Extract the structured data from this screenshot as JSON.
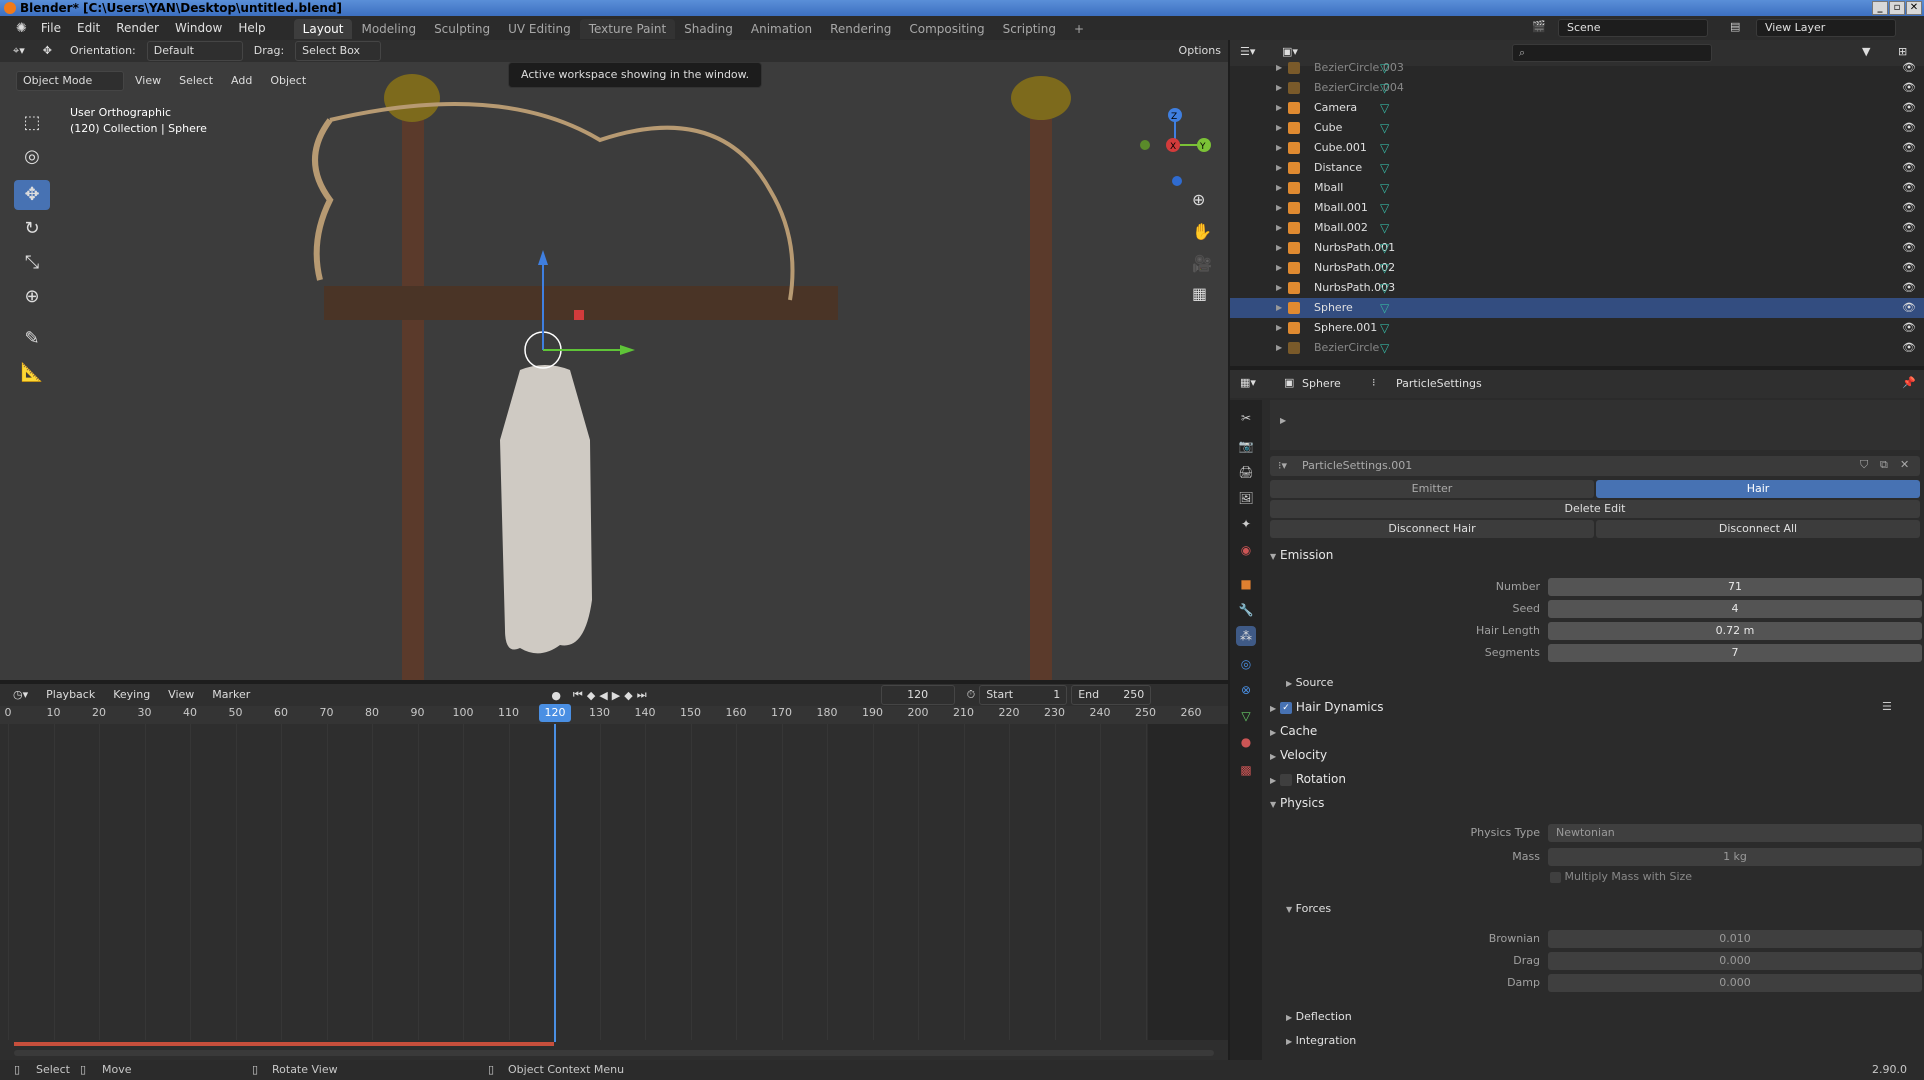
{
  "window": {
    "title": "Blender* [C:\\Users\\YAN\\Desktop\\untitled.blend]"
  },
  "menu": [
    "File",
    "Edit",
    "Render",
    "Window",
    "Help"
  ],
  "workspaces": [
    "Layout",
    "Modeling",
    "Sculpting",
    "UV Editing",
    "Texture Paint",
    "Shading",
    "Animation",
    "Rendering",
    "Compositing",
    "Scripting"
  ],
  "active_workspace": "Layout",
  "scene": {
    "label": "Scene",
    "view_layer": "View Layer"
  },
  "viewport": {
    "orientation_label": "Orientation:",
    "orientation_value": "Default",
    "drag_label": "Drag:",
    "drag_value": "Select Box",
    "options_label": "Options",
    "mode": "Object Mode",
    "header_menus": [
      "View",
      "Select",
      "Add",
      "Object"
    ],
    "tooltip": "Active workspace showing in the window.",
    "overlay_view": "User Orthographic",
    "overlay_collection": "(120) Collection | Sphere",
    "gizmo_axes": {
      "z": "Z",
      "x": "X",
      "y": "Y"
    }
  },
  "timeline": {
    "menus": [
      "Playback",
      "Keying",
      "View",
      "Marker"
    ],
    "current_frame": "120",
    "start_label": "Start",
    "start_value": "1",
    "end_label": "End",
    "end_value": "250",
    "frame_ticks": [
      "0",
      "10",
      "20",
      "30",
      "40",
      "50",
      "60",
      "70",
      "80",
      "90",
      "100",
      "110",
      "120",
      "130",
      "140",
      "150",
      "160",
      "170",
      "180",
      "190",
      "200",
      "210",
      "220",
      "230",
      "240",
      "250",
      "260"
    ]
  },
  "outliner": {
    "items": [
      {
        "label": "BezierCircle.003",
        "faded": true
      },
      {
        "label": "BezierCircle.004",
        "faded": true
      },
      {
        "label": "Camera"
      },
      {
        "label": "Cube"
      },
      {
        "label": "Cube.001"
      },
      {
        "label": "Distance"
      },
      {
        "label": "Mball"
      },
      {
        "label": "Mball.001"
      },
      {
        "label": "Mball.002"
      },
      {
        "label": "NurbsPath.001"
      },
      {
        "label": "NurbsPath.002"
      },
      {
        "label": "NurbsPath.003"
      },
      {
        "label": "Sphere",
        "selected": true
      },
      {
        "label": "Sphere.001"
      },
      {
        "label": "BezierCircle",
        "faded": true
      }
    ]
  },
  "properties": {
    "breadcrumb_object": "Sphere",
    "breadcrumb_settings": "ParticleSettings",
    "settings_name": "ParticleSettings.001",
    "type_tabs": [
      "Emitter",
      "Hair"
    ],
    "active_type": "Hair",
    "delete_edit": "Delete Edit",
    "disconnect_hair": "Disconnect Hair",
    "disconnect_all": "Disconnect All",
    "emission": {
      "title": "Emission",
      "number_label": "Number",
      "number_value": "71",
      "seed_label": "Seed",
      "seed_value": "4",
      "hair_length_label": "Hair Length",
      "hair_length_value": "0.72 m",
      "segments_label": "Segments",
      "segments_value": "7",
      "source": "Source"
    },
    "sections": [
      "Hair Dynamics",
      "Cache",
      "Velocity",
      "Rotation"
    ],
    "hair_dynamics_checked": true,
    "rotation_checked": false,
    "physics": {
      "title": "Physics",
      "type_label": "Physics Type",
      "type_value": "Newtonian",
      "mass_label": "Mass",
      "mass_value": "1 kg",
      "multiply_mass": "Multiply Mass with Size",
      "forces_title": "Forces",
      "brownian_label": "Brownian",
      "brownian_value": "0.010",
      "drag_label": "Drag",
      "drag_value": "0.000",
      "damp_label": "Damp",
      "damp_value": "0.000",
      "deflection": "Deflection",
      "integration": "Integration"
    }
  },
  "status": {
    "select": "Select",
    "move": "Move",
    "rotate_view": "Rotate View",
    "context_menu": "Object Context Menu",
    "version": "2.90.0"
  },
  "colors": {
    "accent": "#4772b3",
    "selection_row": "#334d80",
    "orange": "#f07a1a"
  }
}
